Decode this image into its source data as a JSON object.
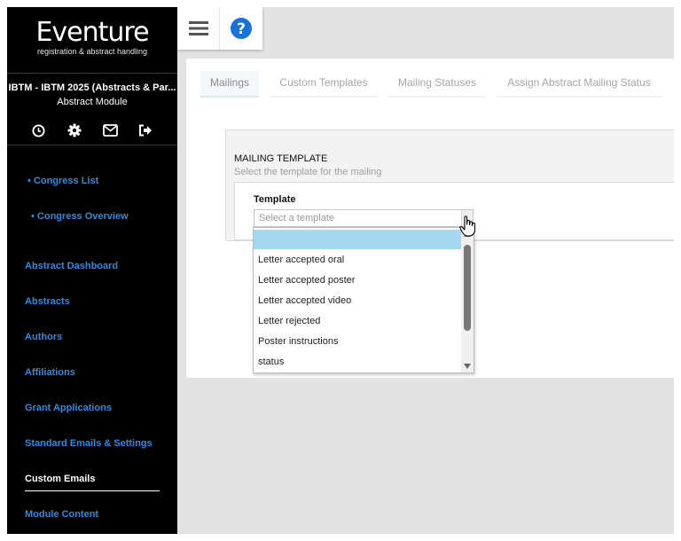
{
  "sidebar": {
    "logo_title": "Eventure",
    "logo_subtitle": "registration & abstract handling",
    "event_title": "IBTM - IBTM 2025 (Abstracts & Par...",
    "module_title": "Abstract Module",
    "icons": [
      "clock-icon",
      "gear-icon",
      "envelope-icon",
      "sign-out-icon"
    ],
    "sub_links": [
      "• Congress List",
      "• Congress Overview"
    ],
    "links": [
      "Abstract Dashboard",
      "Abstracts",
      "Authors",
      "Affiliations",
      "Grant Applications",
      "Standard Emails & Settings",
      "Custom Emails",
      "Module Content"
    ],
    "active_link": "Custom Emails",
    "link_color": "#2a8be2"
  },
  "topbar": {
    "icons": [
      "hamburger-icon",
      "help-icon"
    ],
    "help_color": "#1a73d9"
  },
  "tabs": [
    "Mailings",
    "Custom Templates",
    "Mailing Statuses",
    "Assign Abstract Mailing Status"
  ],
  "active_tab": "Mailings",
  "card": {
    "title": "MAILING TEMPLATE",
    "subtitle": "Select the template for the mailing",
    "field_label": "Template",
    "select_placeholder": "Select a template"
  },
  "dropdown": {
    "options": [
      "",
      "Letter accepted oral",
      "Letter accepted poster",
      "Letter accepted video",
      "Letter rejected",
      "Poster instructions",
      "status"
    ],
    "highlighted_index": 0,
    "highlight_color": "#a4d8f0"
  }
}
